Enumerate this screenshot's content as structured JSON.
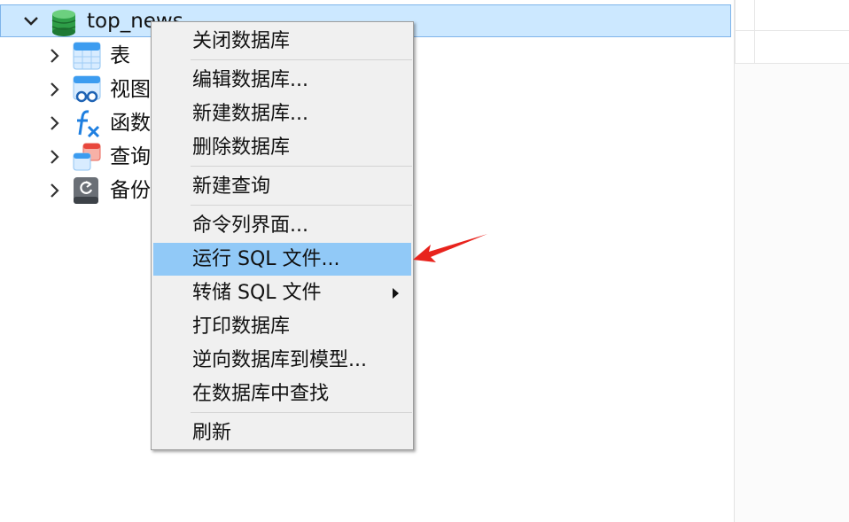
{
  "tree": {
    "database": {
      "name": "top_news",
      "icon": "database-icon",
      "color": "#2e9e48"
    },
    "children": [
      {
        "label": "表",
        "icon": "table-icon"
      },
      {
        "label": "视图",
        "icon": "view-icon"
      },
      {
        "label": "函数",
        "icon": "function-icon"
      },
      {
        "label": "查询",
        "icon": "query-icon"
      },
      {
        "label": "备份",
        "icon": "backup-icon"
      }
    ]
  },
  "context_menu": {
    "items": [
      {
        "label": "关闭数据库"
      },
      {
        "label": "编辑数据库..."
      },
      {
        "label": "新建数据库..."
      },
      {
        "label": "删除数据库"
      },
      {
        "label": "新建查询"
      },
      {
        "label": "命令列界面..."
      },
      {
        "label": "运行 SQL 文件...",
        "highlighted": true
      },
      {
        "label": "转储 SQL 文件",
        "has_submenu": true
      },
      {
        "label": "打印数据库"
      },
      {
        "label": "逆向数据库到模型..."
      },
      {
        "label": "在数据库中查找"
      },
      {
        "label": "刷新"
      }
    ],
    "highlight_color": "#91c9f7"
  },
  "annotation": {
    "icon": "red-arrow-icon",
    "color": "#e8231d"
  }
}
